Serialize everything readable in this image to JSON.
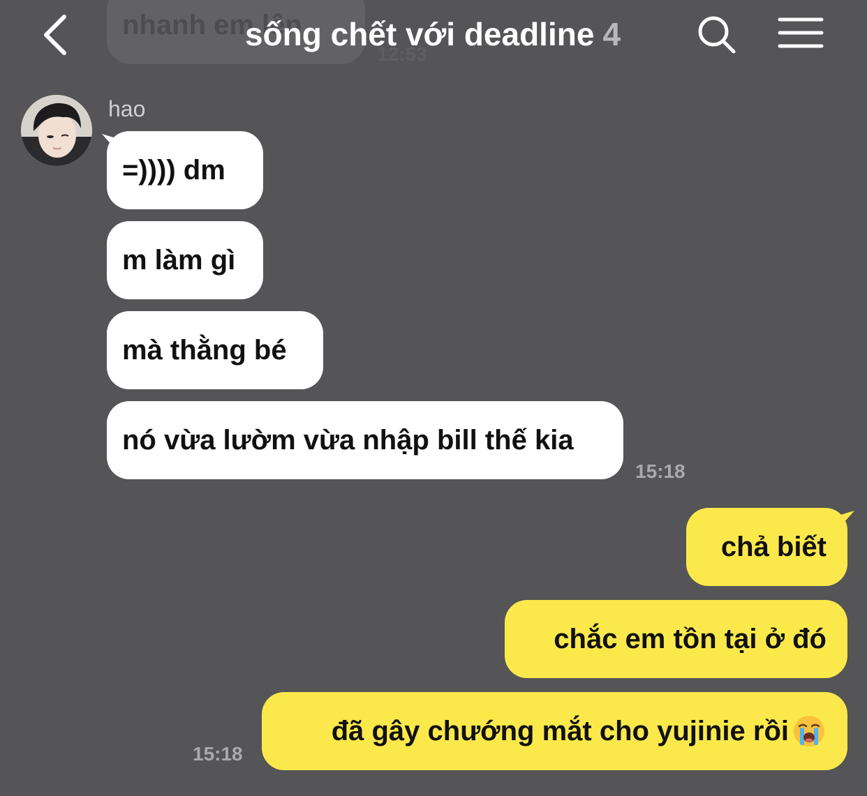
{
  "header": {
    "title": "sống chết với deadline",
    "member_count": "4"
  },
  "ghost_message": {
    "text": "nhanh em lên",
    "time": "12:53"
  },
  "incoming": {
    "sender": "hao",
    "messages": [
      "=)))) dm",
      "m làm gì",
      "mà thằng bé",
      "nó vừa lườm vừa nhập bill thế kia"
    ],
    "time": "15:18"
  },
  "outgoing": {
    "messages": [
      "chả biết",
      "chắc em tồn tại ở đó",
      "đã gây chướng mắt cho yujinie rồi"
    ],
    "time": "15:18",
    "last_emoji": "loudly-crying-face-icon"
  },
  "colors": {
    "background": "#555456",
    "incoming_bubble": "#ffffff",
    "outgoing_bubble": "#fbe94b"
  }
}
